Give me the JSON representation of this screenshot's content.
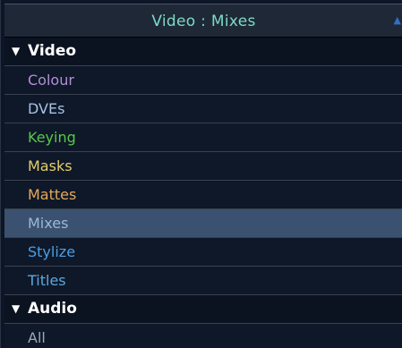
{
  "header": {
    "title": "Video : Mixes",
    "scroll_icon": "triangle-up-icon"
  },
  "categories": [
    {
      "label": "Video",
      "expanded": true,
      "items": [
        {
          "label": "Colour",
          "color": "#b38fd6",
          "selected": false
        },
        {
          "label": "DVEs",
          "color": "#a8c0e8",
          "selected": false
        },
        {
          "label": "Keying",
          "color": "#58c84a",
          "selected": false
        },
        {
          "label": "Masks",
          "color": "#e2cf6a",
          "selected": false
        },
        {
          "label": "Mattes",
          "color": "#e6a85a",
          "selected": false
        },
        {
          "label": "Mixes",
          "color": "#9bb8d6",
          "selected": true
        },
        {
          "label": "Stylize",
          "color": "#4a9ee8",
          "selected": false
        },
        {
          "label": "Titles",
          "color": "#5aa8e0",
          "selected": false
        }
      ]
    },
    {
      "label": "Audio",
      "expanded": true,
      "items": [
        {
          "label": "All",
          "color": "#9aa8b8",
          "selected": false
        }
      ]
    }
  ]
}
